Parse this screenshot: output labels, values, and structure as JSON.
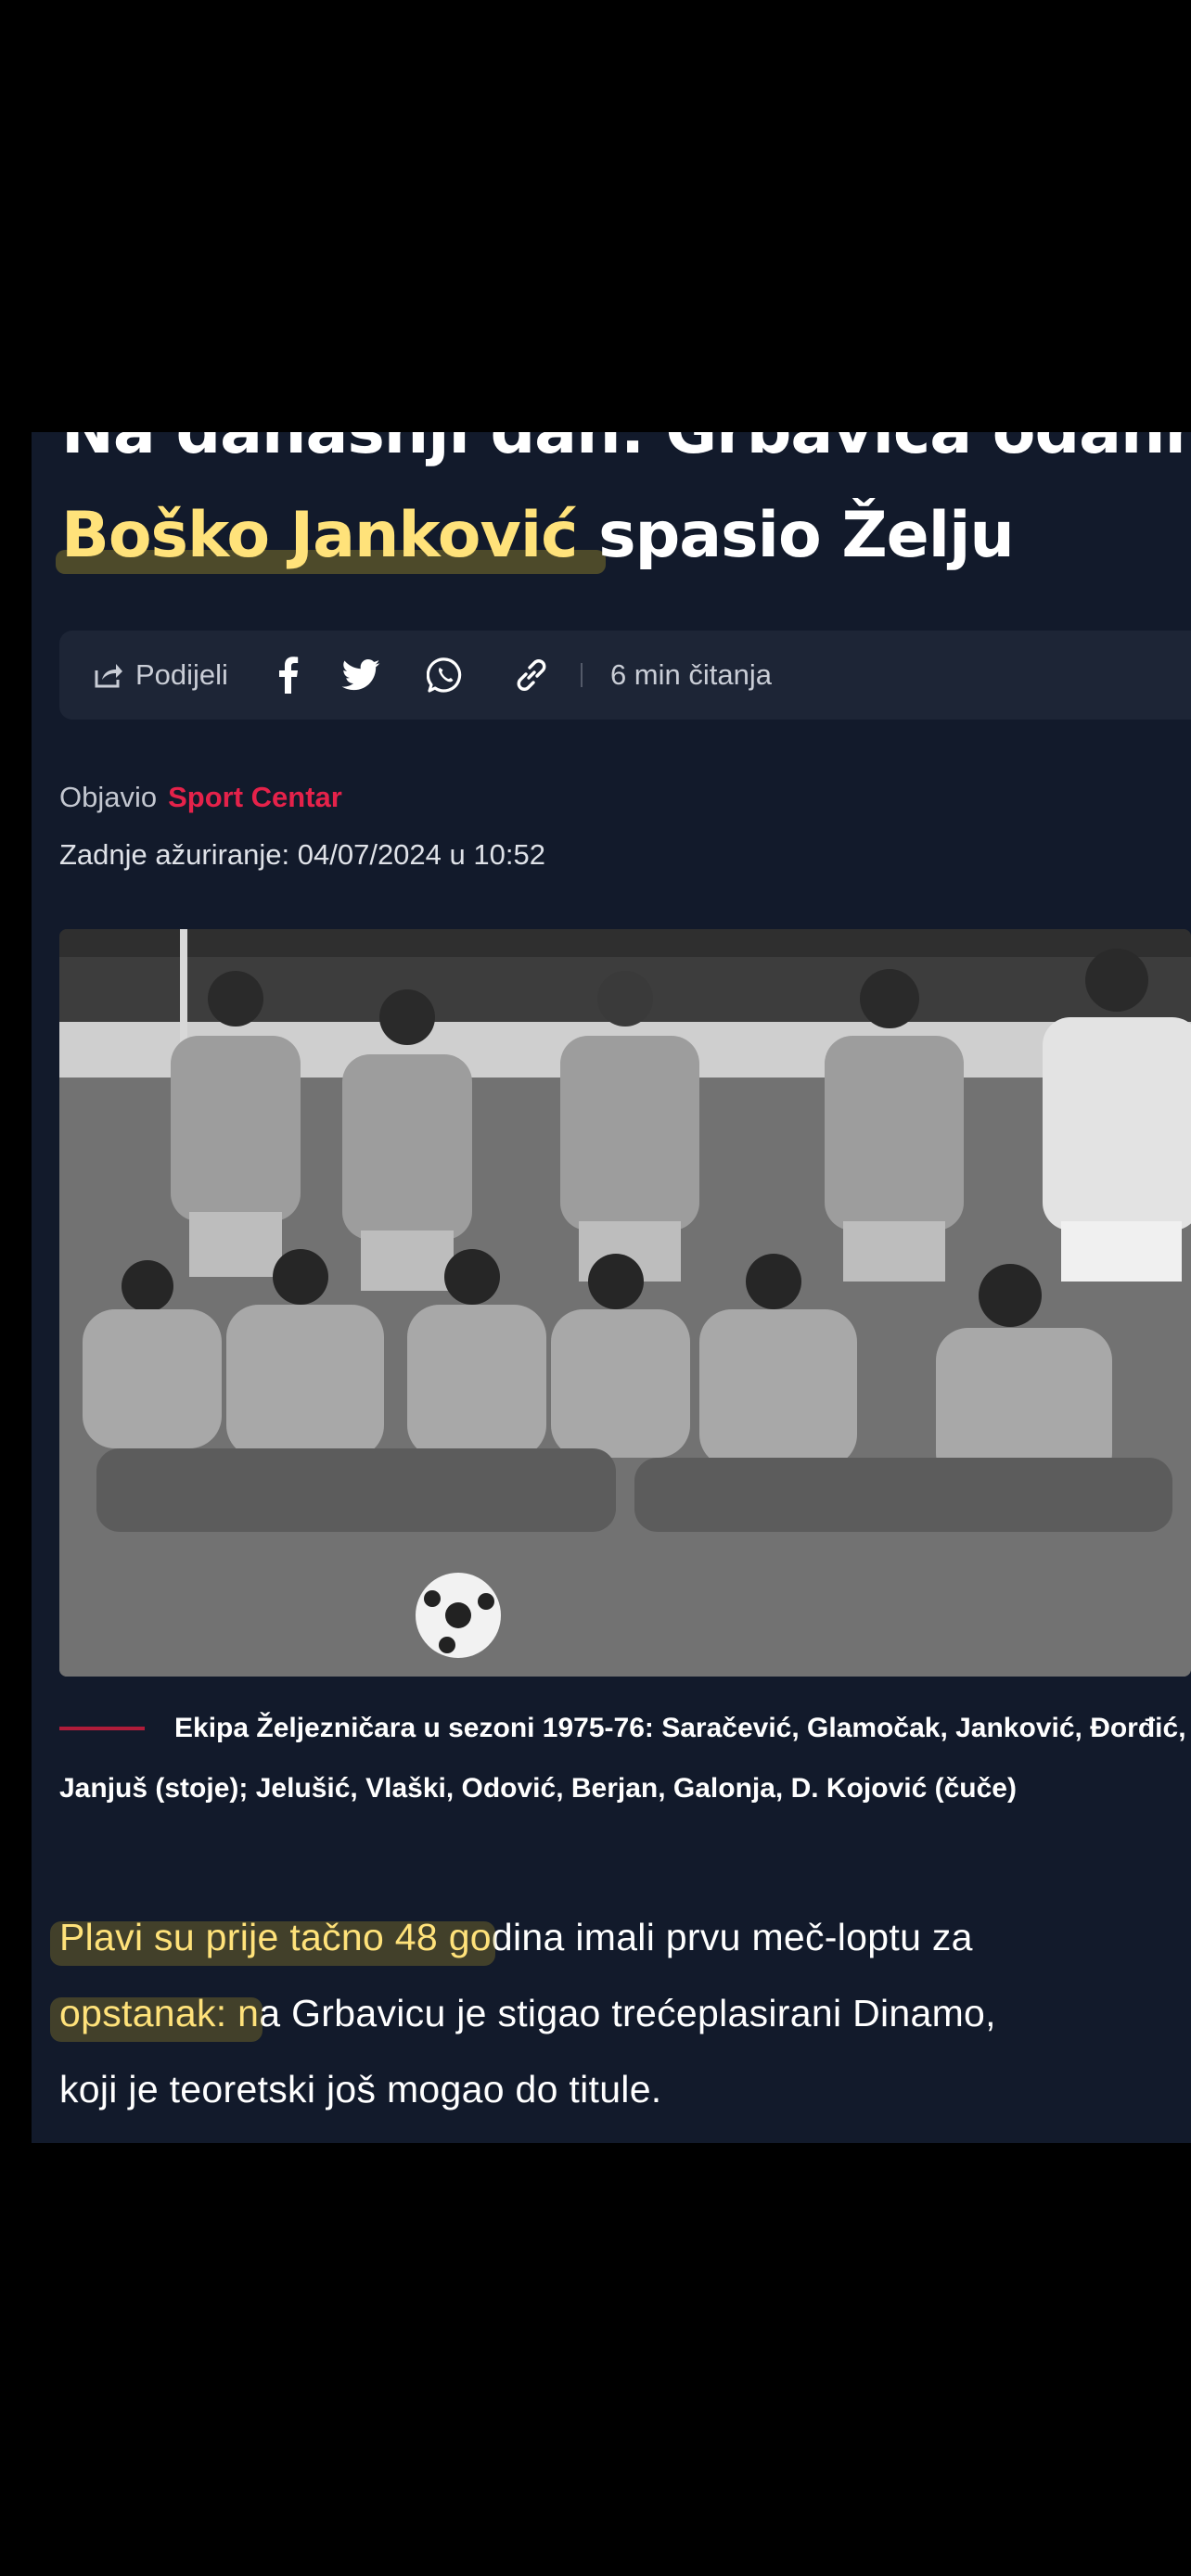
{
  "article": {
    "title_line1": "Na današnji dan: Grbavica odahnula,",
    "title_highlight": "Boško Janković ",
    "title_rest": "spasio Želju",
    "share": {
      "label": "Podijeli",
      "icons": [
        "share-icon",
        "facebook-icon",
        "twitter-icon",
        "whatsapp-icon",
        "link-icon"
      ],
      "read_time": "6 min čitanja"
    },
    "meta": {
      "published_by_label": "Objavio",
      "author": "Sport Centar",
      "updated": "Zadnje ažuriranje: 04/07/2024 u 10:52"
    },
    "caption": {
      "line1": "Ekipa Željezničara u sezoni 1975-76: Saračević, Glamočak, Janković, Đorđić,",
      "line2": "Janjuš (stoje); Jelušić, Vlaški, Odović, Berjan, Galonja, D. Kojović (čuče)"
    },
    "body": {
      "line1_highlight": "Plavi su prije tačno 48 go",
      "line1_rest": "dina imali prvu meč-loptu za",
      "line2_highlight": "opstanak: n",
      "line2_rest": "a Grbavicu je stigao trećeplasirani Dinamo,",
      "line3": "koji je teoretski još mogao do titule."
    }
  },
  "colors": {
    "page_bg": "#121a2b",
    "accent_red": "#e5224a",
    "highlight_yellow": "#ffe27a"
  }
}
